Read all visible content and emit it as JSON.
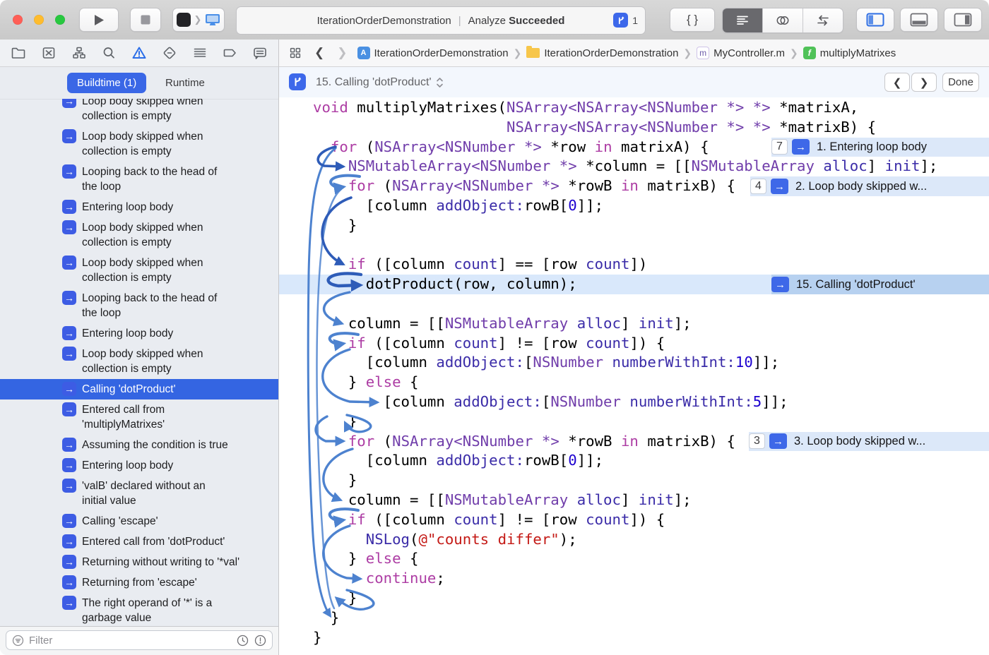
{
  "toolbar": {
    "activity": {
      "project": "IterationOrderDemonstration",
      "separator": "|",
      "action": "Analyze",
      "status": "Succeeded",
      "issue_count": "1"
    },
    "code_button_label": "{ }"
  },
  "navigator_bar": {
    "active": "issue-navigator",
    "icons": [
      "project-navigator",
      "source-control-navigator",
      "symbol-navigator",
      "find-navigator",
      "issue-navigator",
      "test-navigator",
      "debug-navigator",
      "breakpoint-navigator",
      "report-navigator"
    ]
  },
  "jump_bar": {
    "breadcrumbs": [
      {
        "label": "IterationOrderDemonstration",
        "icon": "project-icon"
      },
      {
        "label": "IterationOrderDemonstration",
        "icon": "folder-icon"
      },
      {
        "label": "MyController.m",
        "icon": "objc-file-icon"
      },
      {
        "label": "multiplyMatrixes",
        "icon": "function-icon"
      }
    ]
  },
  "sidebar": {
    "tabs": [
      {
        "label": "Buildtime (1)",
        "active": true
      },
      {
        "label": "Runtime",
        "active": false
      }
    ],
    "items": [
      {
        "lines": [
          "Loop body skipped when",
          "collection is empty"
        ]
      },
      {
        "lines": [
          "Loop body skipped when",
          "collection is empty"
        ]
      },
      {
        "lines": [
          "Looping back to the head of",
          "the loop"
        ]
      },
      {
        "lines": [
          "Entering loop body"
        ]
      },
      {
        "lines": [
          "Loop body skipped when",
          "collection is empty"
        ]
      },
      {
        "lines": [
          "Loop body skipped when",
          "collection is empty"
        ]
      },
      {
        "lines": [
          "Looping back to the head of",
          "the loop"
        ]
      },
      {
        "lines": [
          "Entering loop body"
        ]
      },
      {
        "lines": [
          "Loop body skipped when",
          "collection is empty"
        ]
      },
      {
        "lines": [
          "Calling 'dotProduct'"
        ],
        "selected": true
      },
      {
        "lines": [
          "Entered call from",
          "'multiplyMatrixes'"
        ]
      },
      {
        "lines": [
          "Assuming the condition is true"
        ]
      },
      {
        "lines": [
          "Entering loop body"
        ]
      },
      {
        "lines": [
          "'valB' declared without an",
          "initial value"
        ]
      },
      {
        "lines": [
          "Calling 'escape'"
        ]
      },
      {
        "lines": [
          "Entered call from 'dotProduct'"
        ]
      },
      {
        "lines": [
          "Returning without writing to '*val'"
        ]
      },
      {
        "lines": [
          "Returning from 'escape'"
        ]
      },
      {
        "lines": [
          "The right operand of '*' is a",
          "garbage value"
        ]
      }
    ],
    "filter": {
      "placeholder": "Filter"
    }
  },
  "analysis_bar": {
    "title": "15. Calling 'dotProduct'",
    "done_label": "Done"
  },
  "code": {
    "lines": [
      {
        "i": 0,
        "seg": [
          [
            "k",
            "void"
          ],
          [
            "p",
            " multiplyMatrixes("
          ],
          [
            "t",
            "NSArray<NSArray<NSNumber *> *>"
          ],
          [
            "p",
            " *matrixA,"
          ]
        ]
      },
      {
        "i": 22,
        "seg": [
          [
            "t",
            "NSArray<NSArray<NSNumber *> *>"
          ],
          [
            "p",
            " *matrixB) {"
          ]
        ]
      },
      {
        "i": 2,
        "seg": [
          [
            "k",
            "for"
          ],
          [
            "p",
            " ("
          ],
          [
            "t",
            "NSArray<NSNumber *>"
          ],
          [
            "p",
            " *row "
          ],
          [
            "k",
            "in"
          ],
          [
            "p",
            " matrixA) {"
          ]
        ],
        "ann": {
          "count": "7",
          "label": "1. Entering loop body"
        }
      },
      {
        "i": 4,
        "seg": [
          [
            "t",
            "NSMutableArray<NSNumber *>"
          ],
          [
            "p",
            " *column = [["
          ],
          [
            "t",
            "NSMutableArray"
          ],
          [
            "p",
            " "
          ],
          [
            "m",
            "alloc"
          ],
          [
            "p",
            "] "
          ],
          [
            "m",
            "init"
          ],
          [
            "p",
            "];"
          ]
        ]
      },
      {
        "i": 4,
        "seg": [
          [
            "k",
            "for"
          ],
          [
            "p",
            " ("
          ],
          [
            "t",
            "NSArray<NSNumber *>"
          ],
          [
            "p",
            " *rowB "
          ],
          [
            "k",
            "in"
          ],
          [
            "p",
            " matrixB) {"
          ]
        ],
        "ann": {
          "count": "4",
          "label": "2. Loop body skipped w..."
        }
      },
      {
        "i": 6,
        "seg": [
          [
            "p",
            "[column "
          ],
          [
            "m",
            "addObject:"
          ],
          [
            "p",
            "rowB["
          ],
          [
            "n",
            "0"
          ],
          [
            "p",
            "]];"
          ]
        ]
      },
      {
        "i": 4,
        "seg": [
          [
            "p",
            "}"
          ]
        ]
      },
      {
        "i": 0,
        "seg": []
      },
      {
        "i": 4,
        "seg": [
          [
            "k",
            "if"
          ],
          [
            "p",
            " ([column "
          ],
          [
            "m",
            "count"
          ],
          [
            "p",
            "] == [row "
          ],
          [
            "m",
            "count"
          ],
          [
            "p",
            "])"
          ]
        ]
      },
      {
        "i": 6,
        "seg": [
          [
            "p",
            "dotProduct(row, column);"
          ]
        ],
        "highlight": true,
        "ann": {
          "count": "",
          "label": "15. Calling 'dotProduct'",
          "selected": true
        }
      },
      {
        "i": 0,
        "seg": []
      },
      {
        "i": 4,
        "seg": [
          [
            "p",
            "column = [["
          ],
          [
            "t",
            "NSMutableArray"
          ],
          [
            "p",
            " "
          ],
          [
            "m",
            "alloc"
          ],
          [
            "p",
            "] "
          ],
          [
            "m",
            "init"
          ],
          [
            "p",
            "];"
          ]
        ]
      },
      {
        "i": 4,
        "seg": [
          [
            "k",
            "if"
          ],
          [
            "p",
            " ([column "
          ],
          [
            "m",
            "count"
          ],
          [
            "p",
            "] != [row "
          ],
          [
            "m",
            "count"
          ],
          [
            "p",
            "]) {"
          ]
        ]
      },
      {
        "i": 6,
        "seg": [
          [
            "p",
            "[column "
          ],
          [
            "m",
            "addObject:"
          ],
          [
            "p",
            "["
          ],
          [
            "t",
            "NSNumber"
          ],
          [
            "p",
            " "
          ],
          [
            "m",
            "numberWithInt:"
          ],
          [
            "n",
            "10"
          ],
          [
            "p",
            "]];"
          ]
        ]
      },
      {
        "i": 4,
        "seg": [
          [
            "p",
            "} "
          ],
          [
            "k",
            "else"
          ],
          [
            "p",
            " {"
          ]
        ]
      },
      {
        "i": 8,
        "seg": [
          [
            "p",
            "[column "
          ],
          [
            "m",
            "addObject:"
          ],
          [
            "p",
            "["
          ],
          [
            "t",
            "NSNumber"
          ],
          [
            "p",
            " "
          ],
          [
            "m",
            "numberWithInt:"
          ],
          [
            "n",
            "5"
          ],
          [
            "p",
            "]];"
          ]
        ]
      },
      {
        "i": 4,
        "seg": [
          [
            "p",
            "}"
          ]
        ]
      },
      {
        "i": 4,
        "seg": [
          [
            "k",
            "for"
          ],
          [
            "p",
            " ("
          ],
          [
            "t",
            "NSArray<NSNumber *>"
          ],
          [
            "p",
            " *rowB "
          ],
          [
            "k",
            "in"
          ],
          [
            "p",
            " matrixB) {"
          ]
        ],
        "ann": {
          "count": "3",
          "label": "3. Loop body skipped w..."
        }
      },
      {
        "i": 6,
        "seg": [
          [
            "p",
            "[column "
          ],
          [
            "m",
            "addObject:"
          ],
          [
            "p",
            "rowB["
          ],
          [
            "n",
            "0"
          ],
          [
            "p",
            "]];"
          ]
        ]
      },
      {
        "i": 4,
        "seg": [
          [
            "p",
            "}"
          ]
        ]
      },
      {
        "i": 4,
        "seg": [
          [
            "p",
            "column = [["
          ],
          [
            "t",
            "NSMutableArray"
          ],
          [
            "p",
            " "
          ],
          [
            "m",
            "alloc"
          ],
          [
            "p",
            "] "
          ],
          [
            "m",
            "init"
          ],
          [
            "p",
            "];"
          ]
        ]
      },
      {
        "i": 4,
        "seg": [
          [
            "k",
            "if"
          ],
          [
            "p",
            " ([column "
          ],
          [
            "m",
            "count"
          ],
          [
            "p",
            "] != [row "
          ],
          [
            "m",
            "count"
          ],
          [
            "p",
            "]) {"
          ]
        ]
      },
      {
        "i": 6,
        "seg": [
          [
            "m",
            "NSLog"
          ],
          [
            "p",
            "("
          ],
          [
            "s",
            "@\"counts differ\""
          ],
          [
            "p",
            ");"
          ]
        ]
      },
      {
        "i": 4,
        "seg": [
          [
            "p",
            "} "
          ],
          [
            "k",
            "else"
          ],
          [
            "p",
            " {"
          ]
        ]
      },
      {
        "i": 6,
        "seg": [
          [
            "k",
            "continue"
          ],
          [
            "p",
            ";"
          ]
        ]
      },
      {
        "i": 4,
        "seg": [
          [
            "p",
            "}"
          ]
        ]
      },
      {
        "i": 2,
        "seg": [
          [
            "p",
            "}"
          ]
        ]
      },
      {
        "i": 0,
        "seg": [
          [
            "p",
            "}"
          ]
        ]
      }
    ]
  },
  "colors": {
    "accent_blue": "#3465e2",
    "annotation_bg": "#dce8f9",
    "annotation_selected_bg": "#b7d1f0",
    "keyword": "#ad3da4",
    "type": "#703daa",
    "method": "#3b2ca8",
    "number": "#1c00cf",
    "string": "#c41a16",
    "flow_arrow": "#4d82cf"
  }
}
